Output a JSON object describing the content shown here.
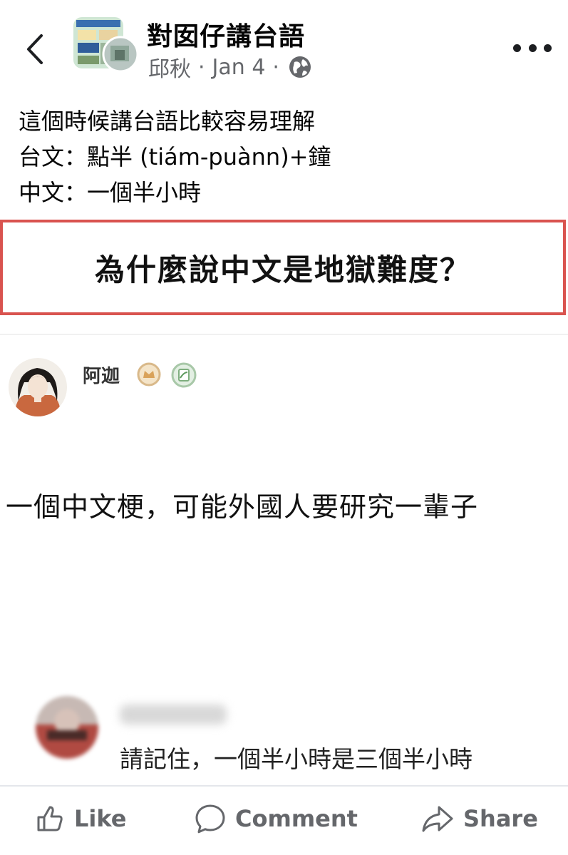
{
  "header": {
    "group_name": "對囡仔講台語",
    "author": "邱秋",
    "date": "Jan 4",
    "separator": "·"
  },
  "post": {
    "lines": [
      "這個時候講台語比較容易理解",
      "台文：點半 (tiám-puànn)+鐘",
      "中文：一個半小時"
    ]
  },
  "shared_image": {
    "banner_text": "為什麼說中文是地獄難度？",
    "commenter_name": "阿迦",
    "meme_text": "一個中文梗，可能外國人要研究一輩子",
    "reply_text": "請記住，一個半小時是三個半小時"
  },
  "actions": {
    "like": "Like",
    "comment": "Comment",
    "share": "Share"
  },
  "colors": {
    "banner_border": "#d9534f",
    "meta_text": "#65676b",
    "action_text": "#65676b"
  }
}
